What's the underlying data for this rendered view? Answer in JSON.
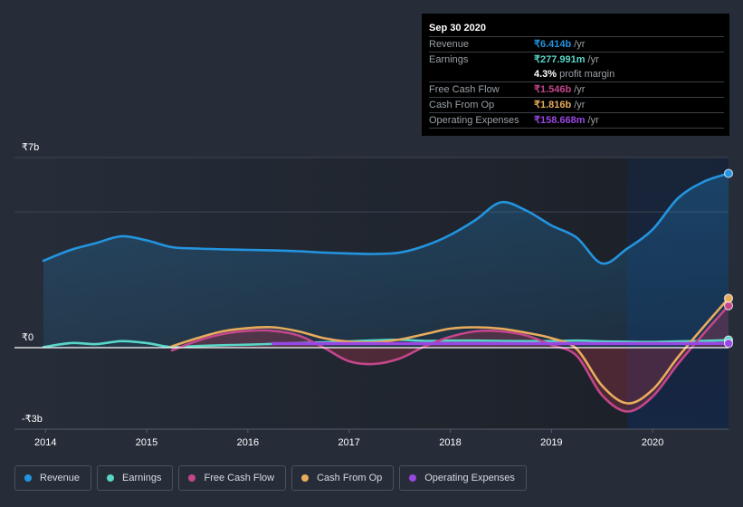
{
  "chart_data": {
    "type": "line",
    "title": "",
    "xlabel": "",
    "ylabel": "",
    "currency_symbol": "₹",
    "x_ticks": [
      "2014",
      "2015",
      "2016",
      "2017",
      "2018",
      "2019",
      "2020"
    ],
    "y_ticks": [
      {
        "value": 7,
        "label": "₹7b"
      },
      {
        "value": 0,
        "label": "₹0"
      },
      {
        "value": -3,
        "label": "-₹3b"
      }
    ],
    "gridlines_at": [
      7,
      5,
      0,
      -3
    ],
    "ylim": [
      -3,
      7
    ],
    "xlim": [
      2013.98,
      2020.75
    ],
    "grid": true,
    "legend_position": "bottom-left",
    "highlight_from": 2019.75,
    "series": [
      {
        "name": "Revenue",
        "key": "revenue",
        "color": "#2394df",
        "filled": true,
        "points": [
          [
            2013.98,
            3.2
          ],
          [
            2014.25,
            3.6
          ],
          [
            2014.5,
            3.85
          ],
          [
            2014.75,
            4.1
          ],
          [
            2015.0,
            3.95
          ],
          [
            2015.25,
            3.7
          ],
          [
            2015.5,
            3.65
          ],
          [
            2015.75,
            3.62
          ],
          [
            2016.0,
            3.6
          ],
          [
            2016.25,
            3.58
          ],
          [
            2016.5,
            3.55
          ],
          [
            2016.75,
            3.5
          ],
          [
            2017.0,
            3.47
          ],
          [
            2017.25,
            3.45
          ],
          [
            2017.5,
            3.5
          ],
          [
            2017.75,
            3.75
          ],
          [
            2018.0,
            4.15
          ],
          [
            2018.25,
            4.7
          ],
          [
            2018.5,
            5.35
          ],
          [
            2018.75,
            5.05
          ],
          [
            2019.0,
            4.5
          ],
          [
            2019.25,
            4.05
          ],
          [
            2019.5,
            3.1
          ],
          [
            2019.75,
            3.65
          ],
          [
            2020.0,
            4.35
          ],
          [
            2020.25,
            5.5
          ],
          [
            2020.5,
            6.1
          ],
          [
            2020.75,
            6.414
          ]
        ]
      },
      {
        "name": "Earnings",
        "key": "earnings",
        "color": "#58d6c6",
        "filled": false,
        "points": [
          [
            2013.98,
            0.02
          ],
          [
            2014.25,
            0.17
          ],
          [
            2014.5,
            0.13
          ],
          [
            2014.75,
            0.24
          ],
          [
            2015.0,
            0.17
          ],
          [
            2015.25,
            0.02
          ],
          [
            2015.5,
            0.06
          ],
          [
            2015.75,
            0.09
          ],
          [
            2016.0,
            0.11
          ],
          [
            2016.25,
            0.14
          ],
          [
            2016.5,
            0.17
          ],
          [
            2016.75,
            0.2
          ],
          [
            2017.0,
            0.23
          ],
          [
            2017.25,
            0.27
          ],
          [
            2017.5,
            0.29
          ],
          [
            2017.75,
            0.25
          ],
          [
            2018.0,
            0.26
          ],
          [
            2018.25,
            0.26
          ],
          [
            2018.5,
            0.25
          ],
          [
            2018.75,
            0.24
          ],
          [
            2019.0,
            0.24
          ],
          [
            2019.25,
            0.26
          ],
          [
            2019.5,
            0.23
          ],
          [
            2019.75,
            0.22
          ],
          [
            2020.0,
            0.21
          ],
          [
            2020.25,
            0.23
          ],
          [
            2020.5,
            0.25
          ],
          [
            2020.75,
            0.278
          ]
        ]
      },
      {
        "name": "Free Cash Flow",
        "key": "fcf",
        "color": "#c3468a",
        "filled": true,
        "points": [
          [
            2015.25,
            -0.1
          ],
          [
            2015.5,
            0.25
          ],
          [
            2015.75,
            0.5
          ],
          [
            2016.0,
            0.62
          ],
          [
            2016.25,
            0.62
          ],
          [
            2016.5,
            0.45
          ],
          [
            2016.75,
            0.0
          ],
          [
            2017.0,
            -0.5
          ],
          [
            2017.25,
            -0.6
          ],
          [
            2017.5,
            -0.4
          ],
          [
            2017.75,
            0.05
          ],
          [
            2018.0,
            0.4
          ],
          [
            2018.25,
            0.6
          ],
          [
            2018.5,
            0.6
          ],
          [
            2018.75,
            0.45
          ],
          [
            2019.0,
            0.1
          ],
          [
            2019.25,
            -0.3
          ],
          [
            2019.5,
            -1.75
          ],
          [
            2019.75,
            -2.35
          ],
          [
            2020.0,
            -1.8
          ],
          [
            2020.25,
            -0.6
          ],
          [
            2020.5,
            0.5
          ],
          [
            2020.75,
            1.546
          ]
        ]
      },
      {
        "name": "Cash From Op",
        "key": "cfo",
        "color": "#e8ac5c",
        "filled": false,
        "points": [
          [
            2015.25,
            0.05
          ],
          [
            2015.5,
            0.35
          ],
          [
            2015.75,
            0.6
          ],
          [
            2016.0,
            0.72
          ],
          [
            2016.25,
            0.75
          ],
          [
            2016.5,
            0.6
          ],
          [
            2016.75,
            0.35
          ],
          [
            2017.0,
            0.22
          ],
          [
            2017.25,
            0.2
          ],
          [
            2017.5,
            0.3
          ],
          [
            2017.75,
            0.5
          ],
          [
            2018.0,
            0.7
          ],
          [
            2018.25,
            0.75
          ],
          [
            2018.5,
            0.7
          ],
          [
            2018.75,
            0.55
          ],
          [
            2019.0,
            0.35
          ],
          [
            2019.25,
            -0.05
          ],
          [
            2019.5,
            -1.4
          ],
          [
            2019.75,
            -2.05
          ],
          [
            2020.0,
            -1.55
          ],
          [
            2020.25,
            -0.35
          ],
          [
            2020.5,
            0.75
          ],
          [
            2020.75,
            1.816
          ]
        ]
      },
      {
        "name": "Operating Expenses",
        "key": "opex",
        "color": "#9747e2",
        "filled": false,
        "points": [
          [
            2016.25,
            0.15
          ],
          [
            2016.75,
            0.15
          ],
          [
            2017.25,
            0.15
          ],
          [
            2017.75,
            0.15
          ],
          [
            2018.25,
            0.15
          ],
          [
            2018.75,
            0.15
          ],
          [
            2019.25,
            0.15
          ],
          [
            2019.75,
            0.15
          ],
          [
            2020.25,
            0.15
          ],
          [
            2020.75,
            0.159
          ]
        ]
      }
    ]
  },
  "tooltip": {
    "date": "Sep 30 2020",
    "rows": [
      {
        "label": "Revenue",
        "value": "₹6.414b",
        "unit": "/yr",
        "color": "#2394df"
      },
      {
        "label": "Earnings",
        "value": "₹277.991m",
        "unit": "/yr",
        "color": "#58d6c6"
      },
      {
        "label": "",
        "value": "4.3%",
        "unit": "profit margin",
        "color": "#ffffff"
      },
      {
        "label": "Free Cash Flow",
        "value": "₹1.546b",
        "unit": "/yr",
        "color": "#c3468a"
      },
      {
        "label": "Cash From Op",
        "value": "₹1.816b",
        "unit": "/yr",
        "color": "#e8ac5c"
      },
      {
        "label": "Operating Expenses",
        "value": "₹158.668m",
        "unit": "/yr",
        "color": "#9747e2"
      }
    ]
  },
  "legend": [
    {
      "label": "Revenue",
      "color": "#2394df"
    },
    {
      "label": "Earnings",
      "color": "#58d6c6"
    },
    {
      "label": "Free Cash Flow",
      "color": "#c3468a"
    },
    {
      "label": "Cash From Op",
      "color": "#e8ac5c"
    },
    {
      "label": "Operating Expenses",
      "color": "#9747e2"
    }
  ]
}
